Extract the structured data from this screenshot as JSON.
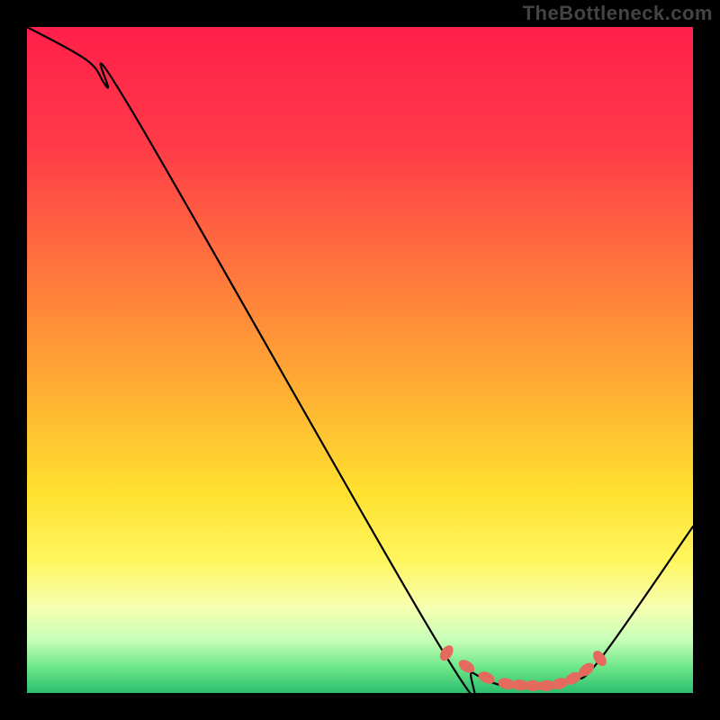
{
  "watermark": "TheBottleneck.com",
  "chart_data": {
    "type": "line",
    "title": "",
    "xlabel": "",
    "ylabel": "",
    "xlim": [
      0,
      100
    ],
    "ylim": [
      0,
      100
    ],
    "grid": false,
    "legend": false,
    "series": [
      {
        "name": "bottleneck-curve",
        "x": [
          0,
          9,
          12,
          16,
          62,
          67,
          72,
          78,
          82,
          86,
          100
        ],
        "y": [
          100,
          95,
          91,
          87,
          7,
          3,
          1,
          1,
          2,
          5,
          25
        ]
      }
    ],
    "markers": {
      "name": "optimal-range",
      "x": [
        63,
        66,
        69,
        72,
        74,
        76,
        78,
        80,
        82,
        84,
        86
      ],
      "y": [
        6,
        4,
        2.3,
        1.4,
        1.2,
        1.1,
        1.1,
        1.4,
        2.2,
        3.5,
        5.2
      ]
    },
    "gradient_stops": [
      {
        "offset": 0.0,
        "color": "#ff1f4b"
      },
      {
        "offset": 0.18,
        "color": "#ff3b48"
      },
      {
        "offset": 0.38,
        "color": "#ff7a3c"
      },
      {
        "offset": 0.55,
        "color": "#ffb033"
      },
      {
        "offset": 0.7,
        "color": "#ffe12f"
      },
      {
        "offset": 0.8,
        "color": "#fff65e"
      },
      {
        "offset": 0.87,
        "color": "#f7ffb0"
      },
      {
        "offset": 0.92,
        "color": "#c8ffb8"
      },
      {
        "offset": 0.96,
        "color": "#6fe88a"
      },
      {
        "offset": 1.0,
        "color": "#2dbd6e"
      }
    ]
  }
}
